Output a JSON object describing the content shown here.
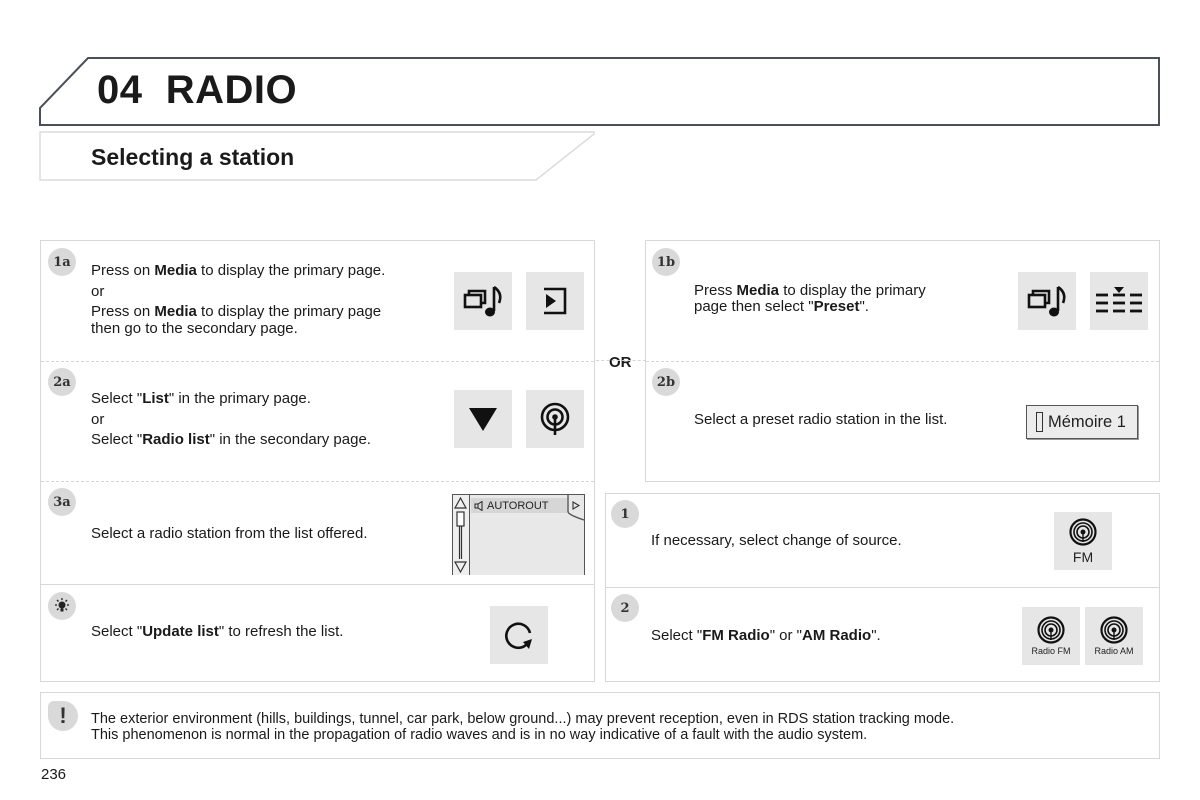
{
  "header": {
    "chapter_number": "04",
    "chapter_title": "RADIO",
    "section_title": "Selecting a station"
  },
  "colors": {
    "title_border": "#4a4f5a",
    "panel_border": "#d8d8d8",
    "icon_bg": "#e6e6e6",
    "badge_bg": "#d9d9d9"
  },
  "left_panel": {
    "steps": [
      {
        "badge": "1a",
        "lines": [
          {
            "parts": [
              {
                "t": "Press on "
              },
              {
                "t": "Media",
                "b": true
              },
              {
                "t": " to display the primary page."
              }
            ]
          },
          {
            "parts": [
              {
                "t": "or"
              }
            ]
          },
          {
            "parts": [
              {
                "t": "Press on "
              },
              {
                "t": "Media",
                "b": true
              },
              {
                "t": " to display the primary page"
              }
            ]
          },
          {
            "parts": [
              {
                "t": "then go to the secondary page."
              }
            ]
          }
        ],
        "icons": [
          "media-icon",
          "secondary-page-icon"
        ]
      },
      {
        "badge": "2a",
        "lines": [
          {
            "parts": [
              {
                "t": "Select \""
              },
              {
                "t": "List",
                "b": true
              },
              {
                "t": "\" in the primary page."
              }
            ]
          },
          {
            "parts": [
              {
                "t": "or"
              }
            ]
          },
          {
            "parts": [
              {
                "t": "Select \""
              },
              {
                "t": "Radio list",
                "b": true
              },
              {
                "t": "\" in the secondary page."
              }
            ]
          }
        ],
        "icons": [
          "list-triangle-icon",
          "radio-list-icon"
        ]
      },
      {
        "badge": "3a",
        "lines": [
          {
            "parts": [
              {
                "t": "Select a radio station from the list offered."
              }
            ]
          }
        ],
        "list_widget": {
          "station": "AUTOROUT"
        }
      },
      {
        "badge": "tip-icon",
        "lines": [
          {
            "parts": [
              {
                "t": "Select \""
              },
              {
                "t": "Update list",
                "b": true
              },
              {
                "t": "\" to refresh the list."
              }
            ]
          }
        ],
        "icons": [
          "refresh-icon"
        ]
      }
    ]
  },
  "or_label": "OR",
  "right_panel": {
    "steps": [
      {
        "badge": "1b",
        "lines": [
          {
            "parts": [
              {
                "t": "Press "
              },
              {
                "t": "Media",
                "b": true
              },
              {
                "t": " to display the primary"
              }
            ]
          },
          {
            "parts": [
              {
                "t": "page then select \""
              },
              {
                "t": "Preset",
                "b": true
              },
              {
                "t": "\"."
              }
            ]
          }
        ],
        "icons": [
          "media-icon",
          "preset-icon"
        ]
      },
      {
        "badge": "2b",
        "lines": [
          {
            "parts": [
              {
                "t": "Select a preset radio station in the list."
              }
            ]
          }
        ],
        "preset_button": "Mémoire 1"
      }
    ]
  },
  "source_panel": {
    "steps": [
      {
        "badge": "1",
        "lines": [
          {
            "parts": [
              {
                "t": "If necessary, select change of source."
              }
            ]
          }
        ],
        "icon_caption": "FM"
      },
      {
        "badge": "2",
        "lines": [
          {
            "parts": [
              {
                "t": "Select \""
              },
              {
                "t": "FM Radio",
                "b": true
              },
              {
                "t": "\" or \""
              },
              {
                "t": "AM Radio",
                "b": true
              },
              {
                "t": "\"."
              }
            ]
          }
        ],
        "icon_captions": [
          "Radio FM",
          "Radio AM"
        ]
      }
    ]
  },
  "note": {
    "icon": "warning-icon",
    "lines": [
      "The exterior environment (hills, buildings, tunnel, car park, below ground...) may prevent reception, even in RDS station tracking mode.",
      "This phenomenon is normal in the propagation of radio waves and is in no way indicative of a fault with the audio system."
    ]
  },
  "page_number": "236"
}
